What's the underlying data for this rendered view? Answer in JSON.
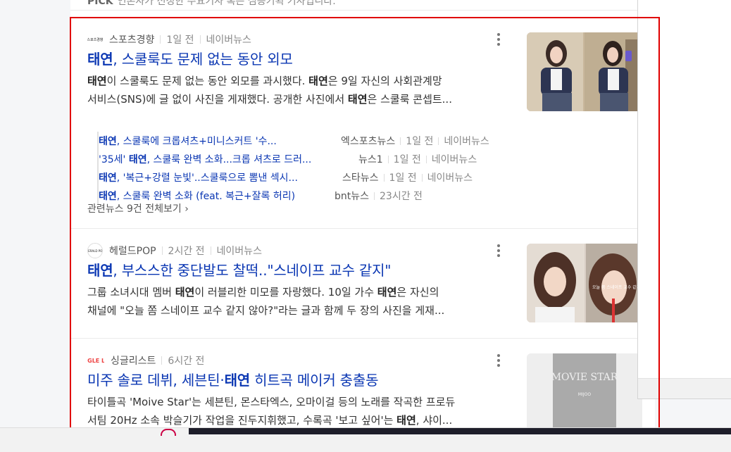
{
  "top_partial": {
    "prefix": "PICK",
    "text": "언론사가 선정한 주요기사 혹은 심층기획 기사입니다."
  },
  "articles": [
    {
      "press": "스포츠경향",
      "logo_text": "스포츠경향",
      "time": "1일 전",
      "via": "네이버뉴스",
      "title_b": "태연",
      "title_rest": ", 스쿨룩도 문제 없는 동안 외모",
      "desc1": [
        "태연",
        "이 스쿨룩도 문제 없는 동안 외모를 과시했다. ",
        "태연",
        "은 9일 자신의 사회관계망"
      ],
      "desc2": [
        "서비스(SNS)에 글 없이 사진을 게재했다. 공개한 사진에서 ",
        "태연",
        "은 스쿨룩 콘셉트..."
      ],
      "related": [
        {
          "b": "태연",
          "t": ", 스쿨룩에 크롭셔츠+미니스커트 '수...",
          "press": "엑스포츠뉴스",
          "time": "1일 전",
          "via": "네이버뉴스"
        },
        {
          "pre": "'35세' ",
          "b": "태연",
          "t": ", 스쿨룩 완벽 소화...크롭 셔츠로 드러...",
          "press": "뉴스1",
          "time": "1일 전",
          "via": "네이버뉴스"
        },
        {
          "b": "태연",
          "t": ", '복근+강렬 눈빛'..스쿨룩으로 뽐낸 섹시...",
          "press": "스타뉴스",
          "time": "1일 전",
          "via": "네이버뉴스"
        },
        {
          "b": "태연",
          "t": ", 스쿨룩 완벽 소화 (feat. 복근+잘록 허리)",
          "press": "bnt뉴스",
          "time": "23시간 전",
          "via": ""
        }
      ],
      "all_link": "관련뉴스 9건 전체보기"
    },
    {
      "press": "헤럴드POP",
      "logo_text": "HERALD POP",
      "time": "2시간 전",
      "via": "네이버뉴스",
      "title_b": "태연",
      "title_rest": ", 부스스한 중단발도 찰떡..\"스네이프 교수 같지\"",
      "desc1": [
        "그룹 소녀시대 멤버 ",
        "태연",
        "이 러블리한 미모를 자랑했다. 10일 가수 ",
        "태연",
        "은 자신의"
      ],
      "desc2": [
        "채널에 \"오늘 쫌 스네이프 교수 같지 않아?\"라는 글과 함께 두 장의 사진을 게재..."
      ],
      "thumb_caption": "오늘 쫌 스네이프 교수 같지"
    },
    {
      "press": "싱글리스트",
      "logo_text": "SINGLE LIST",
      "time": "6시간 전",
      "via": "",
      "title_pre": "미주 솔로 데뷔, 세븐틴·",
      "title_b": "태연",
      "title_rest": " 히트곡 메이커 충출동",
      "desc1": [
        "타이틀곡 'Moive Star'는 세븐틴, 몬스타엑스, 오마이걸 등의 노래를 작곡한 프로듀"
      ],
      "desc2": [
        "서팀 20Hz 소속 박슬기가 작업을 진두지휘했고, 수록곡 '보고 싶어'는 ",
        "태연",
        ", 샤이..."
      ],
      "thumb_title": "MOVIE STAR",
      "thumb_sub": "MIJOO"
    }
  ],
  "colors": {
    "link": "#0b37b3",
    "highlight": "#e00000"
  }
}
